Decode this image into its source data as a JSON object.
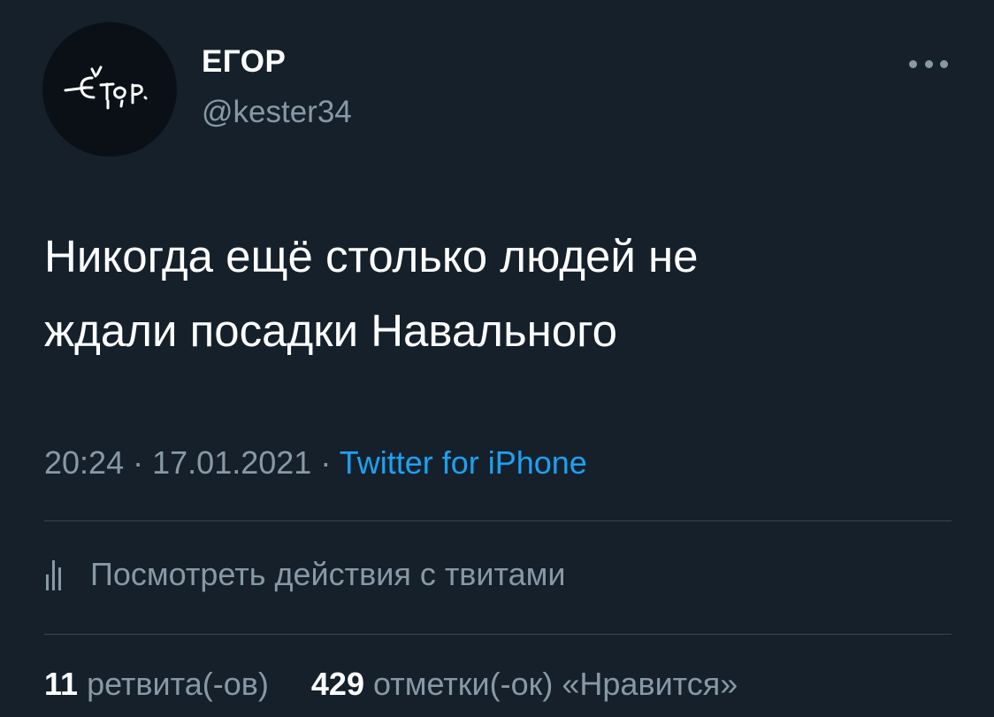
{
  "author": {
    "name": "ЕГОР",
    "handle": "@kester34",
    "avatar_text": "Егор"
  },
  "tweet": {
    "text": "Никогда ещё столько людей не\nждали посадки Навального",
    "time": "20:24",
    "date": "17.01.2021",
    "separator": "·",
    "source": "Twitter for iPhone"
  },
  "analytics": {
    "label": "Посмотреть действия с твитами"
  },
  "stats": {
    "retweets_count": "11",
    "retweets_label": "ретвита(-ов)",
    "likes_count": "429",
    "likes_label": "отметки(-ок) «Нравится»"
  },
  "colors": {
    "background": "#15202b",
    "text": "#ffffff",
    "secondary": "#8899a6",
    "accent": "#1da1f2",
    "divider": "#38444d"
  },
  "icons": {
    "more": "more-dots-icon",
    "analytics": "analytics-bars-icon"
  }
}
